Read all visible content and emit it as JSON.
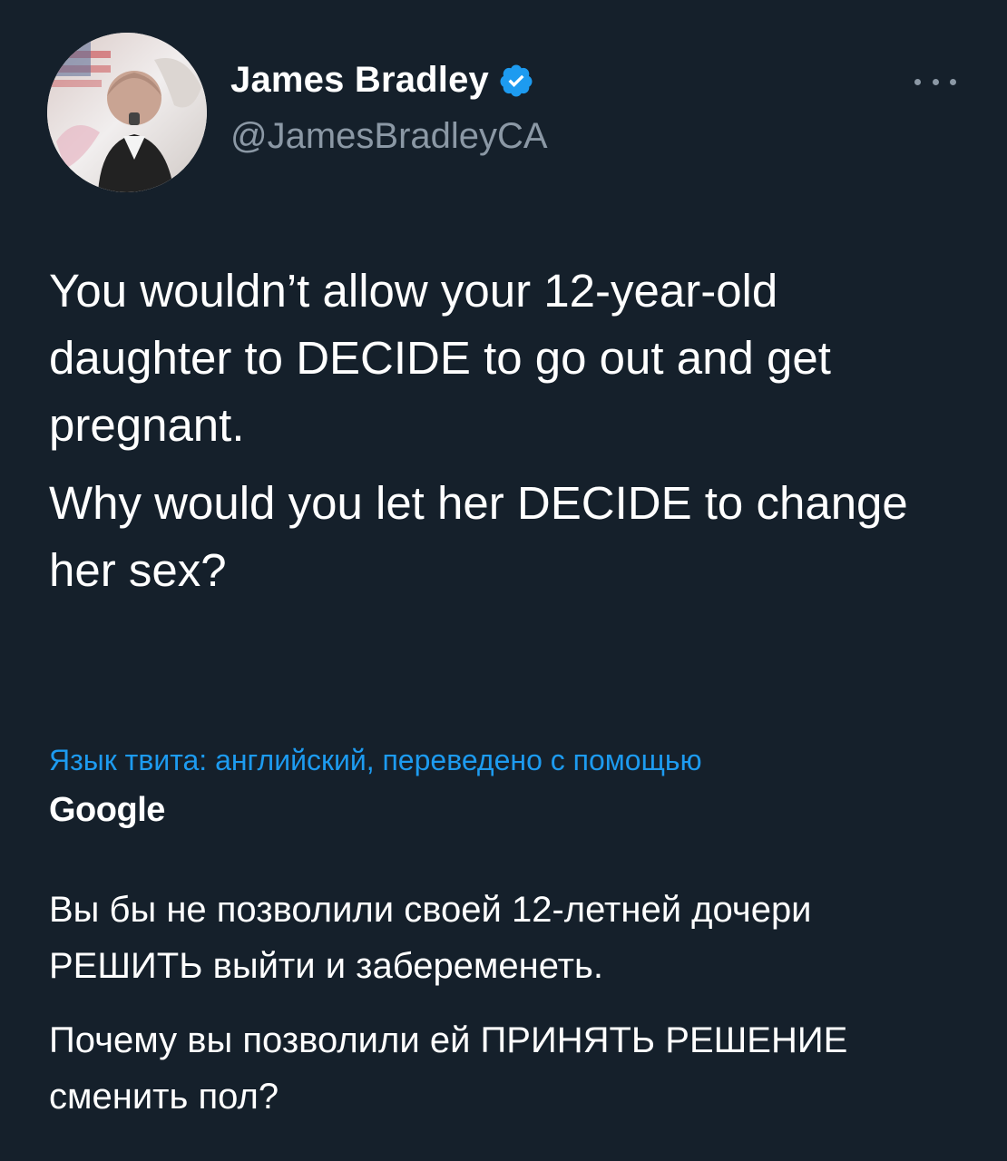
{
  "author": {
    "display_name": "James Bradley",
    "handle": "@JamesBradleyCA",
    "verified": true
  },
  "tweet": {
    "paragraphs": [
      "You wouldn’t allow your 12-year-old daughter to DECIDE to go out and get pregnant.",
      "Why would you let her DECIDE to change her sex?"
    ]
  },
  "translation": {
    "note": "Язык твита: английский, переведено с помощью",
    "provider": "Google",
    "paragraphs": [
      "Вы бы не позволили своей 12-летней дочери РЕШИТЬ выйти и забеременеть.",
      "Почему вы позволили ей ПРИНЯТЬ РЕШЕНИЕ сменить пол?"
    ]
  },
  "icons": {
    "verified": "verified-badge-icon",
    "more": "more-options-icon"
  },
  "colors": {
    "background": "#15202b",
    "text": "#ffffff",
    "secondary_text": "#8b98a5",
    "link": "#1d9bf0",
    "verified": "#1d9bf0"
  }
}
